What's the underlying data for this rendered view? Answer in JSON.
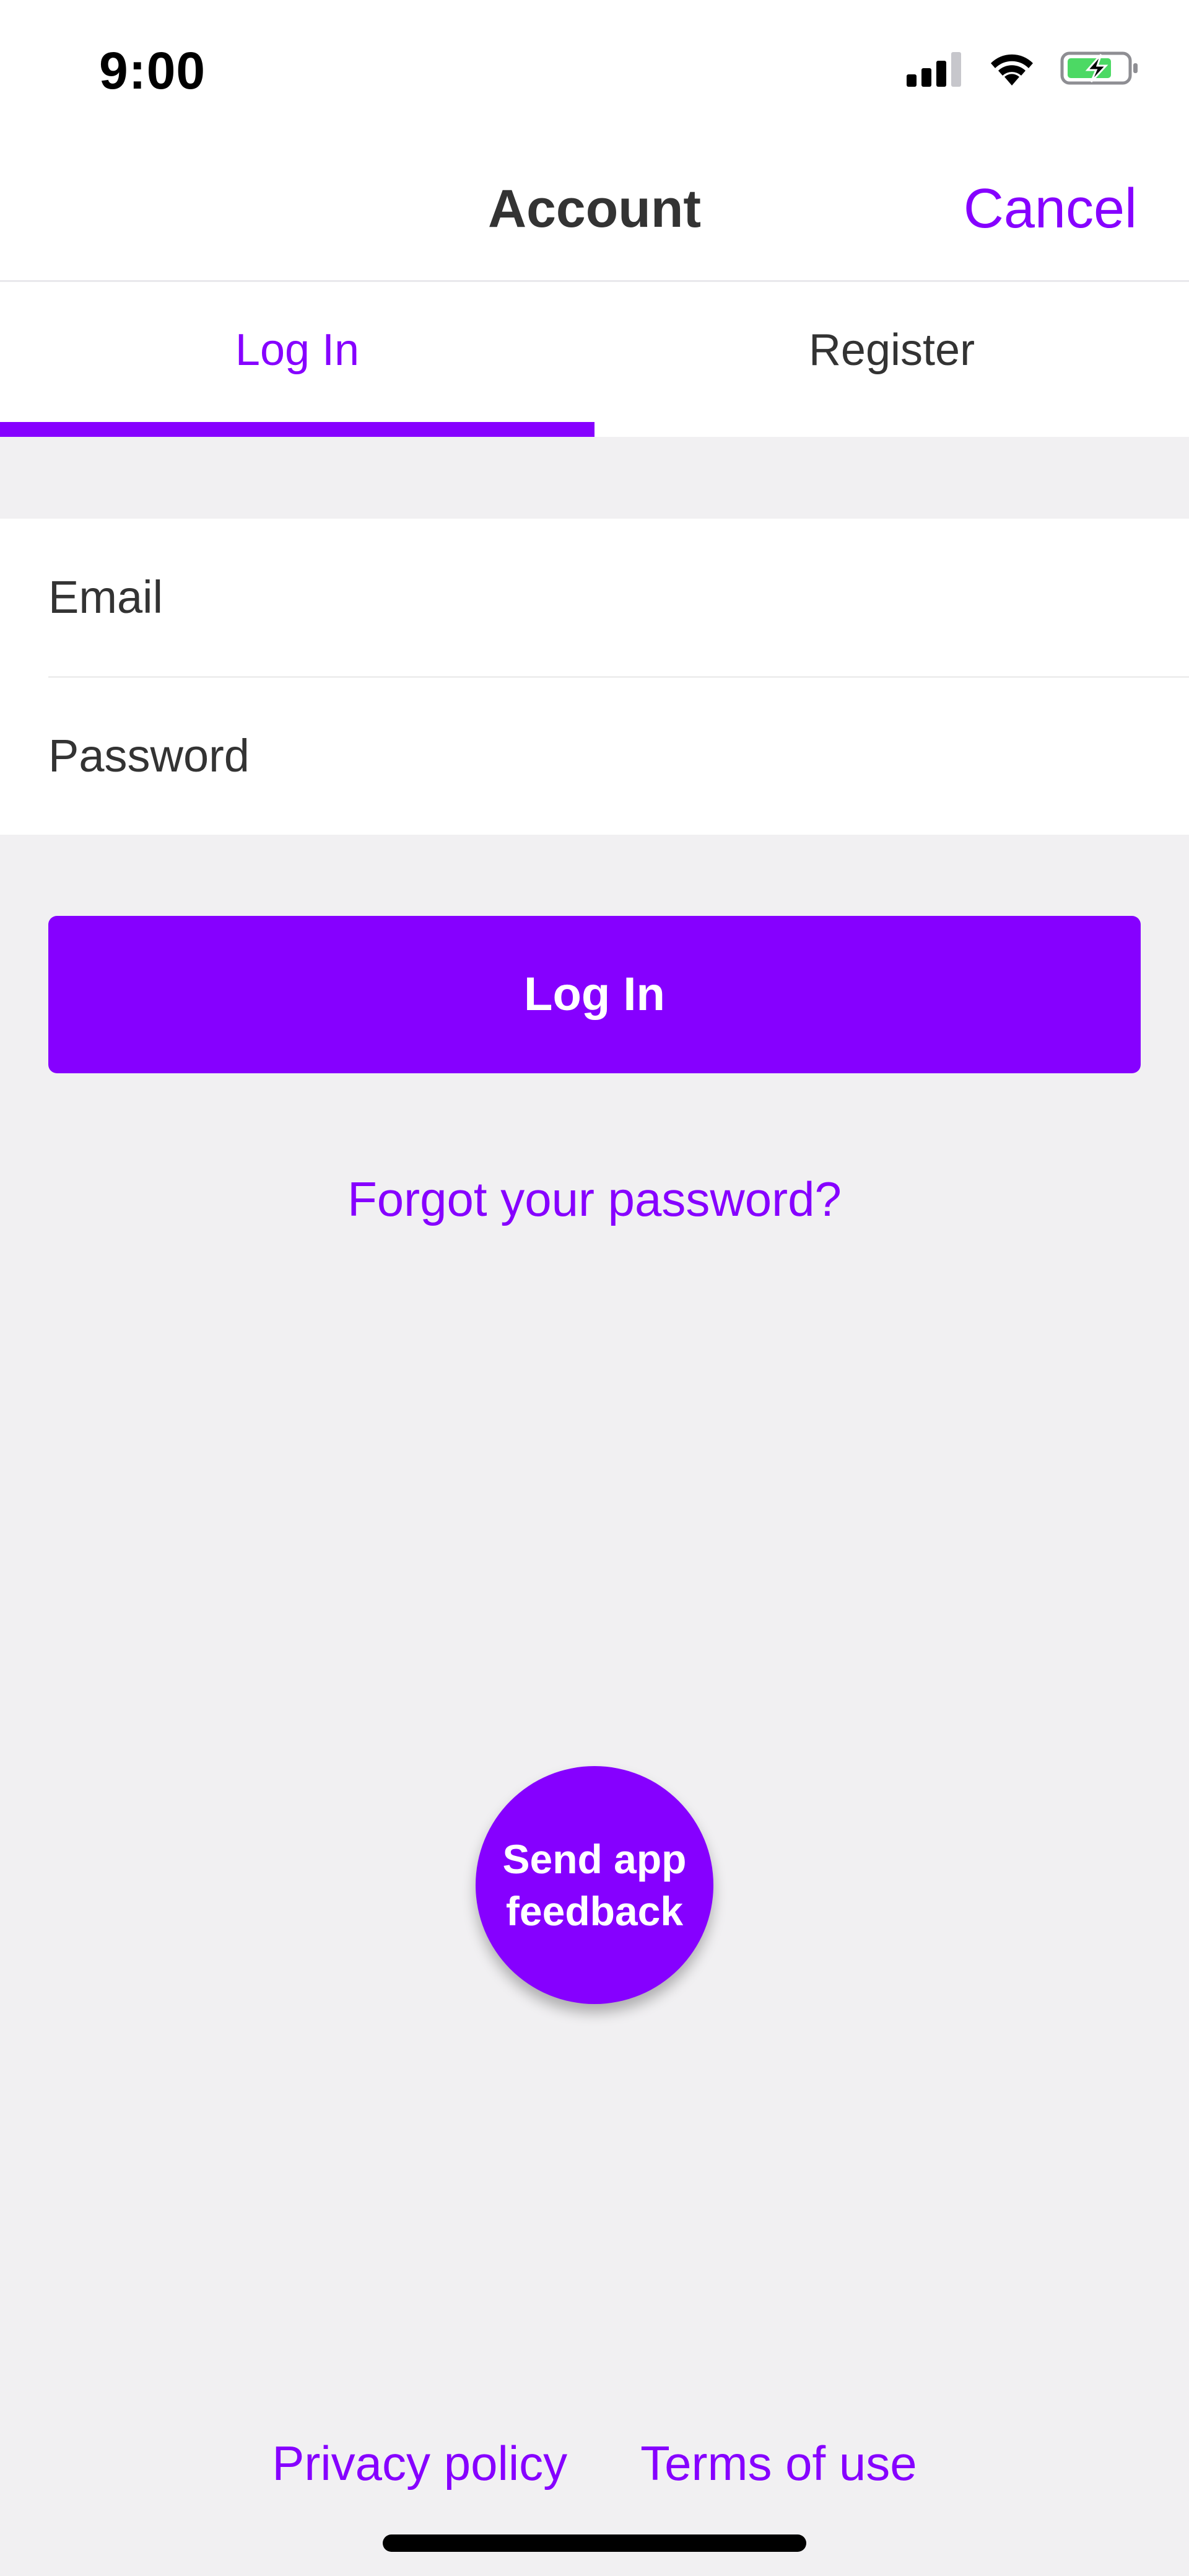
{
  "status_bar": {
    "time": "9:00",
    "icons": [
      "cellular-signal-icon",
      "wifi-icon",
      "battery-charging-icon"
    ],
    "battery_color": "#4cd964"
  },
  "nav": {
    "title": "Account",
    "cancel_label": "Cancel"
  },
  "tabs": [
    {
      "label": "Log In",
      "active": true
    },
    {
      "label": "Register",
      "active": false
    }
  ],
  "form": {
    "email_placeholder": "Email",
    "password_placeholder": "Password",
    "submit_label": "Log In",
    "forgot_label": "Forgot your password?"
  },
  "feedback": {
    "line1": "Send app",
    "line2": "feedback"
  },
  "footer": {
    "privacy_label": "Privacy policy",
    "terms_label": "Terms of use"
  },
  "colors": {
    "accent": "#8600ff",
    "background": "#f1f0f2",
    "text": "#333333"
  }
}
